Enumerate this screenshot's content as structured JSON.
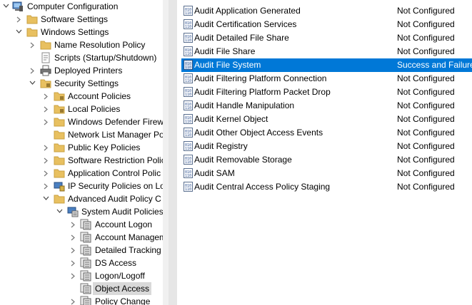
{
  "tree": {
    "computer_configuration": "Computer Configuration",
    "software_settings": "Software Settings",
    "windows_settings": "Windows Settings",
    "name_resolution_policy": "Name Resolution Policy",
    "scripts": "Scripts (Startup/Shutdown)",
    "deployed_printers": "Deployed Printers",
    "security_settings": "Security Settings",
    "account_policies": "Account Policies",
    "local_policies": "Local Policies",
    "windows_defender_firewall": "Windows Defender Firew",
    "network_list_manager": "Network List Manager Po",
    "public_key_policies": "Public Key Policies",
    "software_restriction": "Software Restriction Polic",
    "application_control": "Application Control Polic",
    "ip_security": "IP Security Policies on Lo",
    "advanced_audit": "Advanced Audit Policy C",
    "system_audit_policies": "System Audit Policies",
    "account_logon": "Account Logon",
    "account_management": "Account Managem",
    "detailed_tracking": "Detailed Tracking",
    "ds_access": "DS Access",
    "logon_logoff": "Logon/Logoff",
    "object_access": "Object Access",
    "policy_change": "Policy Change"
  },
  "policies": [
    {
      "name": "Audit Application Generated",
      "setting": "Not Configured"
    },
    {
      "name": "Audit Certification Services",
      "setting": "Not Configured"
    },
    {
      "name": "Audit Detailed File Share",
      "setting": "Not Configured"
    },
    {
      "name": "Audit File Share",
      "setting": "Not Configured"
    },
    {
      "name": "Audit File System",
      "setting": "Success and Failure"
    },
    {
      "name": "Audit Filtering Platform Connection",
      "setting": "Not Configured"
    },
    {
      "name": "Audit Filtering Platform Packet Drop",
      "setting": "Not Configured"
    },
    {
      "name": "Audit Handle Manipulation",
      "setting": "Not Configured"
    },
    {
      "name": "Audit Kernel Object",
      "setting": "Not Configured"
    },
    {
      "name": "Audit Other Object Access Events",
      "setting": "Not Configured"
    },
    {
      "name": "Audit Registry",
      "setting": "Not Configured"
    },
    {
      "name": "Audit Removable Storage",
      "setting": "Not Configured"
    },
    {
      "name": "Audit SAM",
      "setting": "Not Configured"
    },
    {
      "name": "Audit Central Access Policy Staging",
      "setting": "Not Configured"
    }
  ],
  "colors": {
    "selection": "#0078d7",
    "tree_selection": "#d9d9d9",
    "folder": "#e8c060"
  }
}
